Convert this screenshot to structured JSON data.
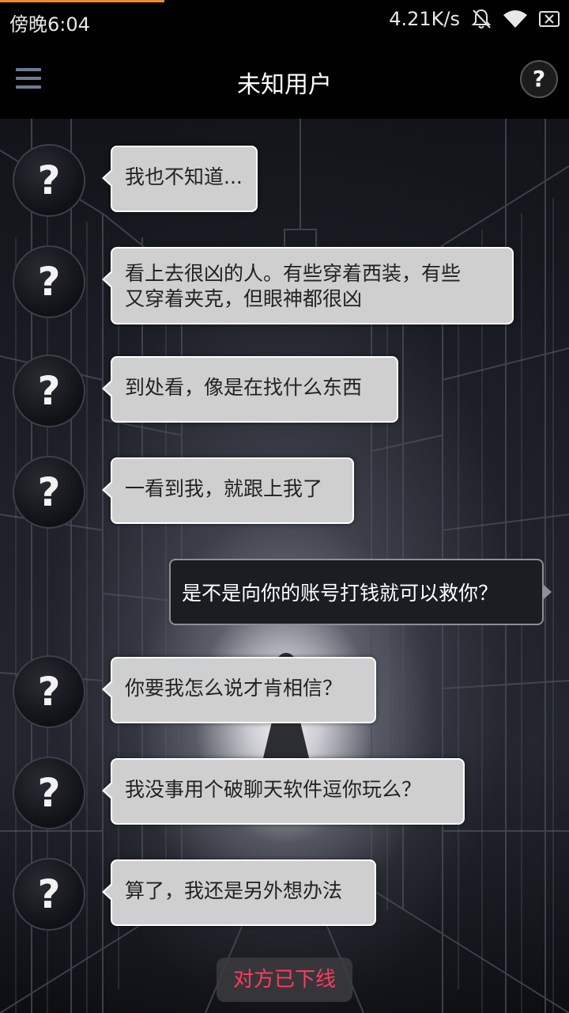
{
  "status_bar": {
    "time": "傍晚6:04",
    "network_speed": "4.21K/s",
    "icons": [
      "bell-muted-icon",
      "wifi-icon",
      "sim-none-icon"
    ]
  },
  "nav": {
    "menu_icon": "hamburger-menu-icon",
    "title": "未知用户",
    "help_label": "?"
  },
  "avatar_label": "?",
  "messages": [
    {
      "from": "other",
      "lines": [
        "我也不知道..."
      ]
    },
    {
      "from": "other",
      "lines": [
        "看上去很凶的人。有些穿着西装，有些",
        "又穿着夹克，但眼神都很凶"
      ]
    },
    {
      "from": "other",
      "lines": [
        "到处看，像是在找什么东西"
      ]
    },
    {
      "from": "other",
      "lines": [
        "一看到我，就跟上我了"
      ]
    },
    {
      "from": "me",
      "lines": [
        "是不是向你的账号打钱就可以救你？"
      ]
    },
    {
      "from": "other",
      "lines": [
        "你要我怎么说才肯相信？"
      ]
    },
    {
      "from": "other",
      "lines": [
        "我没事用个破聊天软件逗你玩么？"
      ]
    },
    {
      "from": "other",
      "lines": [
        "算了，我还是另外想办法"
      ]
    }
  ],
  "offline_notice": "对方已下线",
  "colors": {
    "bubble_other": "#cfcfcf",
    "bubble_me": "#1b1d22",
    "offline_text": "#ff3b5c",
    "progress": "#f08a2c"
  }
}
